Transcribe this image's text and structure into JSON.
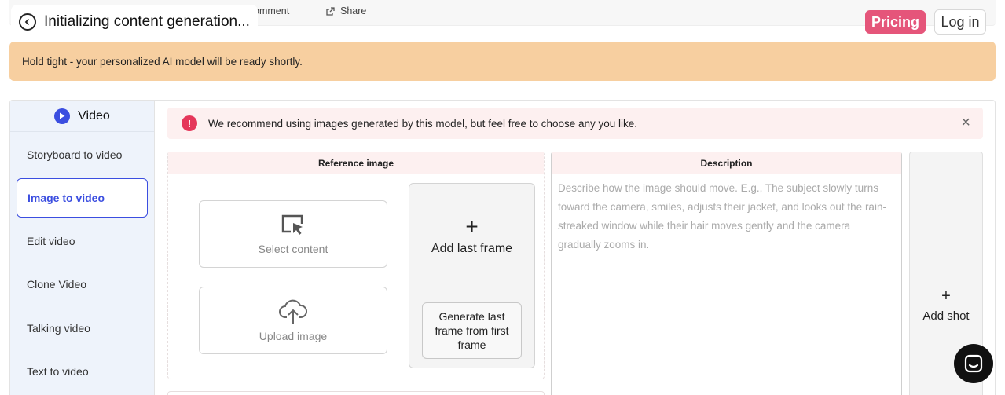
{
  "header": {
    "title": "Initializing content generation...",
    "comment_label": "Comment",
    "share_label": "Share",
    "pricing_label": "Pricing",
    "login_label": "Log in"
  },
  "banner": {
    "text": "Hold tight - your personalized AI model will be ready shortly."
  },
  "sidebar": {
    "heading": "Video",
    "items": [
      {
        "label": "Storyboard to video"
      },
      {
        "label": "Image to video",
        "active": true
      },
      {
        "label": "Edit video"
      },
      {
        "label": "Clone Video"
      },
      {
        "label": "Talking video"
      },
      {
        "label": "Text to video"
      }
    ]
  },
  "recommendation": {
    "text": "We recommend using images generated by this model, but feel free to choose any you like.",
    "close": "×"
  },
  "reference": {
    "heading": "Reference image",
    "select_label": "Select content",
    "upload_label": "Upload image",
    "add_last_frame_plus": "+",
    "add_last_frame_label": "Add last frame",
    "generate_label": "Generate last frame from first frame"
  },
  "description": {
    "heading": "Description",
    "placeholder": "Describe how the image should move. E.g., The subject slowly turns toward the camera, smiles, adjusts their jacket, and looks out the rain-streaked window while their hair moves gently and the camera gradually zooms in."
  },
  "add_shot": {
    "plus": "+",
    "label": "Add shot"
  },
  "colors": {
    "accent": "#3b4ee0",
    "pricing": "#e5557a",
    "banner": "#f7cfa0",
    "info": "#e5375a"
  }
}
